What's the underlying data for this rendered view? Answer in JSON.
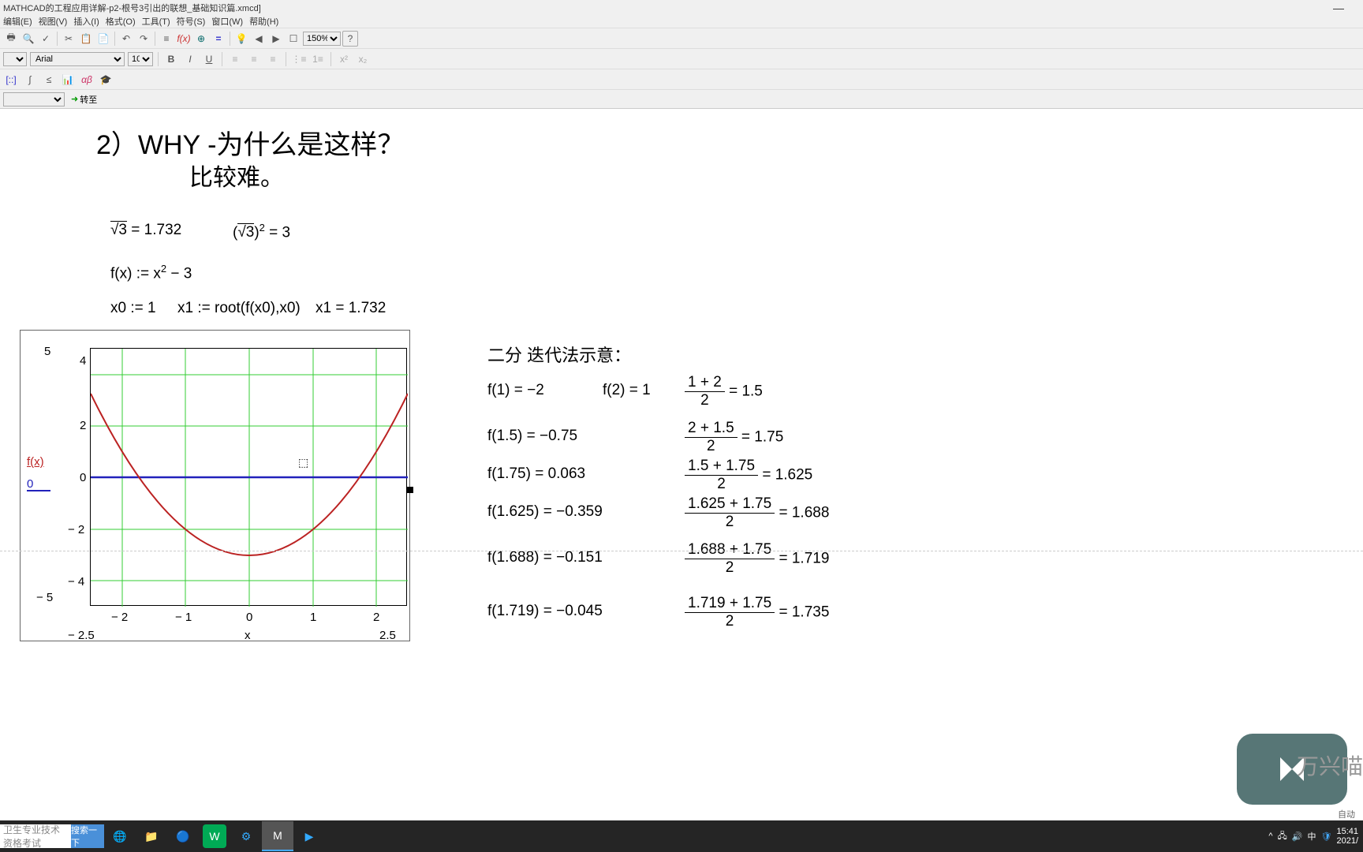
{
  "title": "MATHCAD的工程应用详解-p2-根号3引出的联想_基础知识篇.xmcd]",
  "menu": {
    "edit": "编辑(E)",
    "view": "视图(V)",
    "insert": "插入(I)",
    "format": "格式(O)",
    "tools": "工具(T)",
    "symbol": "符号(S)",
    "window": "窗口(W)",
    "help": "帮助(H)"
  },
  "toolbar": {
    "zoom": "150%",
    "font": "Arial",
    "size": "10",
    "nav_btn": "转至"
  },
  "content": {
    "heading": "2）WHY  -为什么是这样？",
    "subheading": "比较难。",
    "sqrt3": "√3 = 1.732",
    "sqrt3sq_lhs": "(√3)",
    "sqrt3sq_exp": "2",
    "sqrt3sq_rhs": " = 3",
    "fx_def": "f(x) := x",
    "fx_exp": "2",
    "fx_rest": " − 3",
    "x0": "x0 := 1",
    "x1_def": "x1 := root(f(x0),x0)",
    "x1_val": "x1 = 1.732",
    "bisection_title": "二分 迭代法示意：",
    "iterations": [
      {
        "f": "f(1) = −2",
        "extra": "f(2) = 1",
        "frac_n": "1 + 2",
        "frac_d": "2",
        "res": "= 1.5"
      },
      {
        "f": "f(1.5) = −0.75",
        "frac_n": "2 + 1.5",
        "frac_d": "2",
        "res": "= 1.75"
      },
      {
        "f": "f(1.75) = 0.063",
        "frac_n": "1.5 + 1.75",
        "frac_d": "2",
        "res": "= 1.625"
      },
      {
        "f": "f(1.625) = −0.359",
        "frac_n": "1.625 + 1.75",
        "frac_d": "2",
        "res": "= 1.688"
      },
      {
        "f": "f(1.688) = −0.151",
        "frac_n": "1.688 + 1.75",
        "frac_d": "2",
        "res": "= 1.719"
      },
      {
        "f": "f(1.719) = −0.045",
        "frac_n": "1.719 + 1.75",
        "frac_d": "2",
        "res": "= 1.735"
      }
    ],
    "plot": {
      "ylabel_top": "f(x)",
      "ylabel_bot": "0",
      "y_ticks": [
        "4",
        "2",
        "0",
        "− 2",
        "− 4"
      ],
      "y_lim_top": "5",
      "y_lim_bot": "− 5",
      "x_ticks": [
        "− 2",
        "− 1",
        "0",
        "1",
        "2"
      ],
      "x_lim_left": "− 2.5",
      "x_lim_right": "2.5",
      "xlabel": "x"
    }
  },
  "chart_data": {
    "type": "line",
    "title": "",
    "xlabel": "x",
    "ylabel": "f(x)",
    "xlim": [
      -2.5,
      2.5
    ],
    "ylim": [
      -5,
      5
    ],
    "series": [
      {
        "name": "f(x)=x²−3",
        "color": "#b22",
        "x": [
          -2.5,
          -2,
          -1.5,
          -1,
          -0.5,
          0,
          0.5,
          1,
          1.5,
          2,
          2.5
        ],
        "values": [
          3.25,
          1,
          -0.75,
          -2,
          -2.75,
          -3,
          -2.75,
          -2,
          -0.75,
          1,
          3.25
        ]
      },
      {
        "name": "0",
        "color": "#22b",
        "x": [
          -2.5,
          2.5
        ],
        "values": [
          0,
          0
        ]
      }
    ]
  },
  "status": {
    "auto": "自动"
  },
  "taskbar": {
    "search_ph": "卫生专业技术资格考试",
    "search_btn": "搜索一下"
  },
  "systray": {
    "ime": "中",
    "time": "15:41",
    "date": "2021/"
  },
  "watermark": "万兴喵"
}
